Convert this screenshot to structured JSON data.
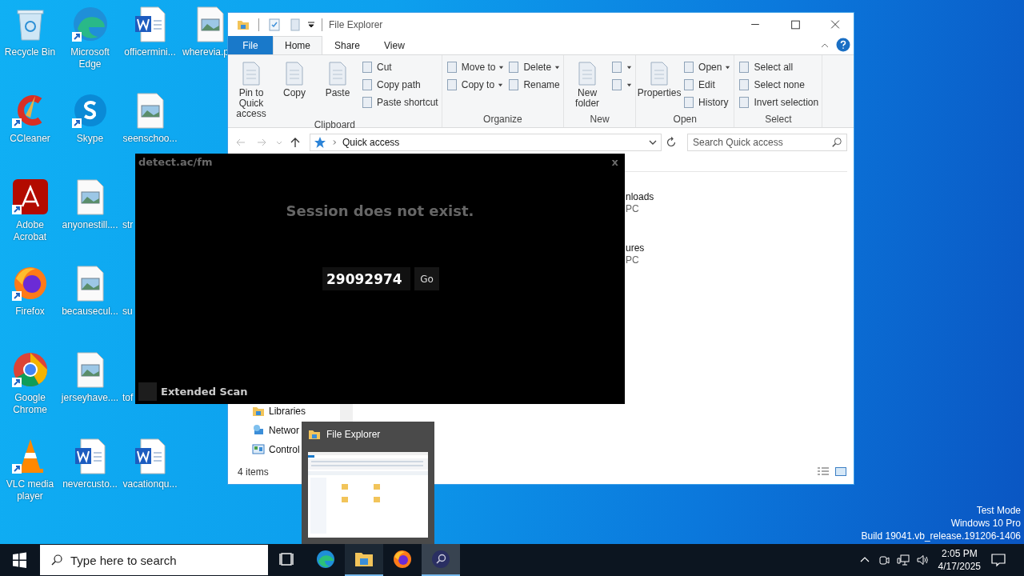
{
  "desktop": {
    "icons": [
      {
        "label": "Recycle Bin",
        "kind": "recycle",
        "shortcut": false
      },
      {
        "label": "CCleaner",
        "kind": "ccleaner",
        "shortcut": true
      },
      {
        "label": "Adobe Acrobat",
        "kind": "acrobat",
        "shortcut": true
      },
      {
        "label": "Firefox",
        "kind": "firefox",
        "shortcut": true
      },
      {
        "label": "Google Chrome",
        "kind": "chrome",
        "shortcut": true
      },
      {
        "label": "VLC media player",
        "kind": "vlc",
        "shortcut": true
      },
      {
        "label": "Microsoft Edge",
        "kind": "edge",
        "shortcut": true
      },
      {
        "label": "Skype",
        "kind": "skype",
        "shortcut": true
      },
      {
        "label": "anyonestill....",
        "kind": "image",
        "shortcut": false
      },
      {
        "label": "becausecul...",
        "kind": "image",
        "shortcut": false
      },
      {
        "label": "jerseyhave....",
        "kind": "image",
        "shortcut": false
      },
      {
        "label": "nevercusto...",
        "kind": "word",
        "shortcut": false
      },
      {
        "label": "officermini...",
        "kind": "word",
        "shortcut": false
      },
      {
        "label": "seenschoo...",
        "kind": "image",
        "shortcut": false
      },
      {
        "label": "str",
        "kind": "covered",
        "clipped": true
      },
      {
        "label": "su",
        "kind": "covered",
        "clipped": true
      },
      {
        "label": "tof",
        "kind": "covered",
        "clipped": true
      },
      {
        "label": "vacationqu...",
        "kind": "word",
        "shortcut": false
      },
      {
        "label": "wherevia.p",
        "kind": "image",
        "shortcut": false,
        "clipped": true
      }
    ],
    "watermark": [
      "Test Mode",
      "Windows 10 Pro",
      "Build 19041.vb_release.191206-1406"
    ]
  },
  "explorer": {
    "title": "File Explorer",
    "file_tab": "File",
    "tabs": [
      {
        "label": "Home",
        "selected": true
      },
      {
        "label": "Share",
        "selected": false
      },
      {
        "label": "View",
        "selected": false
      }
    ],
    "groups": [
      {
        "label": "Clipboard",
        "controls": [
          {
            "kind": "large",
            "label": "Pin to Quick access"
          },
          {
            "kind": "large",
            "label": "Copy"
          },
          {
            "kind": "large",
            "label": "Paste"
          },
          {
            "kind": "stack",
            "items": [
              {
                "label": "Cut",
                "dropdown": false
              },
              {
                "label": "Copy path",
                "dropdown": false
              },
              {
                "label": "Paste shortcut",
                "dropdown": false
              }
            ]
          }
        ]
      },
      {
        "label": "Organize",
        "controls": [
          {
            "kind": "stack",
            "items": [
              {
                "label": "Move to",
                "dropdown": true
              },
              {
                "label": "Copy to",
                "dropdown": true
              }
            ]
          },
          {
            "kind": "stack",
            "items": [
              {
                "label": "Delete",
                "dropdown": true
              },
              {
                "label": "Rename",
                "dropdown": false
              }
            ]
          }
        ]
      },
      {
        "label": "New",
        "controls": [
          {
            "kind": "large",
            "label": "New folder"
          },
          {
            "kind": "stack",
            "items": [
              {
                "dropdown": true
              },
              {
                "dropdown": true
              }
            ]
          }
        ]
      },
      {
        "label": "Open",
        "controls": [
          {
            "kind": "large",
            "label": "Properties"
          },
          {
            "kind": "stack",
            "items": [
              {
                "label": "Open",
                "dropdown": true
              },
              {
                "label": "Edit",
                "dropdown": false
              },
              {
                "label": "History",
                "dropdown": false
              }
            ]
          }
        ]
      },
      {
        "label": "Select",
        "controls": [
          {
            "kind": "stack",
            "items": [
              {
                "label": "Select all",
                "dropdown": false
              },
              {
                "label": "Select none",
                "dropdown": false
              },
              {
                "label": "Invert selection",
                "dropdown": false
              }
            ]
          }
        ]
      }
    ],
    "address": "Quick access",
    "search": {
      "placeholder": "Search Quick access"
    },
    "nav": [
      {
        "label": "Libraries",
        "kind": "library"
      },
      {
        "label": "Networ",
        "kind": "network"
      },
      {
        "label": "Control",
        "kind": "panel"
      }
    ],
    "items": [
      {
        "name": "nloads",
        "location": "PC"
      },
      {
        "name": "ures",
        "location": "PC"
      }
    ],
    "status": "4 items"
  },
  "popup": {
    "title": "detect.ac/fm",
    "close": "x",
    "message": "Session does not exist.",
    "code": "29092974",
    "go": "Go",
    "option": {
      "label": "Extended Scan",
      "checked": false
    }
  },
  "preview": {
    "title": "File Explorer"
  },
  "taskbar": {
    "search": {
      "placeholder": "Type here to search"
    },
    "apps": [
      {
        "kind": "taskview",
        "running": false,
        "selected": false
      },
      {
        "kind": "edge",
        "running": false,
        "selected": false
      },
      {
        "kind": "explorer",
        "running": true,
        "selected": false
      },
      {
        "kind": "firefox",
        "running": false,
        "selected": false
      },
      {
        "kind": "magnifier",
        "running": true,
        "selected": true
      }
    ],
    "time": "2:05 PM",
    "date": "4/17/2025"
  }
}
